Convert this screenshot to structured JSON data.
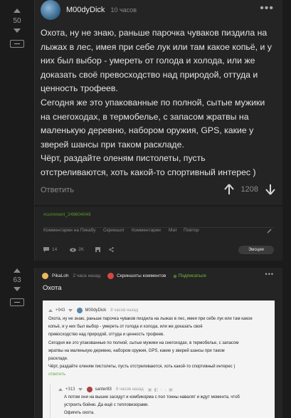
{
  "comment1": {
    "score": "50",
    "username": "M00dyDick",
    "time": "10 часов",
    "paragraphs": [
      "Охота, ну не знаю, раньше парочка чуваков пиздила на лыжах в лес, имея при себе лук или там какое копьё, и у них был выбор - умереть от голода и холода, или же доказать своё превосходство над природой, оттуда и ценность трофеев.",
      "Сегодня же это упакованные по полной, сытые мужики на снегоходах, в термобелье, с запасом жратвы на маленькую деревню, набором оружия, GPS, какие у зверей шансы при таком раскладе.",
      "Чёрт, раздайте оленям пистолеты, пусть отстреливаются, хоть какой-то спортивный интерес )"
    ],
    "reply_label": "Ответить",
    "rating": "1208"
  },
  "post": {
    "hashtag": "#comment_249604049",
    "links": [
      "Комментарии на Пикабу",
      "Скриншот",
      "Комментарии",
      "Мат",
      "Повтор"
    ],
    "comments_count": "14",
    "views": "2K",
    "emotions_label": "Эмоции"
  },
  "post2": {
    "score": "63",
    "author": "PikaLoh",
    "time": "2 часа назад",
    "community": "Скриншоты комментов",
    "subscribe": "Подписаться",
    "title": "Охота",
    "shot": {
      "score": "+943",
      "user": "M00dyDick",
      "time": "8 часов назад",
      "text": [
        "Охота, ну не знаю, раньше парочка чуваков пиздила на лыжах в лес, имея при себе лук или там какое",
        "копьё, и у них был выбор - умереть от голода и холода, или же доказать своё",
        "превосходство над природой, оттуда и ценность трофеев.",
        "Сегодня же это упакованные по полной, сытые мужики на снегоходах, в термобелье, с запасом",
        "жратвы на маленькую деревню, набором оружия, GPS, какие у зверей шансы при таком",
        "раскладе.",
        "Чёрт, раздайте оленям пистолеты, пусть отстреливаются, хоть какой-то спортивный интерес )"
      ],
      "reply_label": "ответить",
      "reply_score": "+313",
      "reply_user": "santer83",
      "reply_time": "8 часов назад",
      "reply_text": [
        "А потом они на вышке засядут и комбикорма с пол тонны навалят и ждут момента, чтоб",
        "устроить бойню. Да ещё с тепловизорами.",
        "Офигеть охота."
      ]
    }
  },
  "colors": {
    "background": "#1b1b1b",
    "card": "#242424",
    "accent_green": "#7bbf3c",
    "hashtag_green": "#5a9a2a"
  }
}
